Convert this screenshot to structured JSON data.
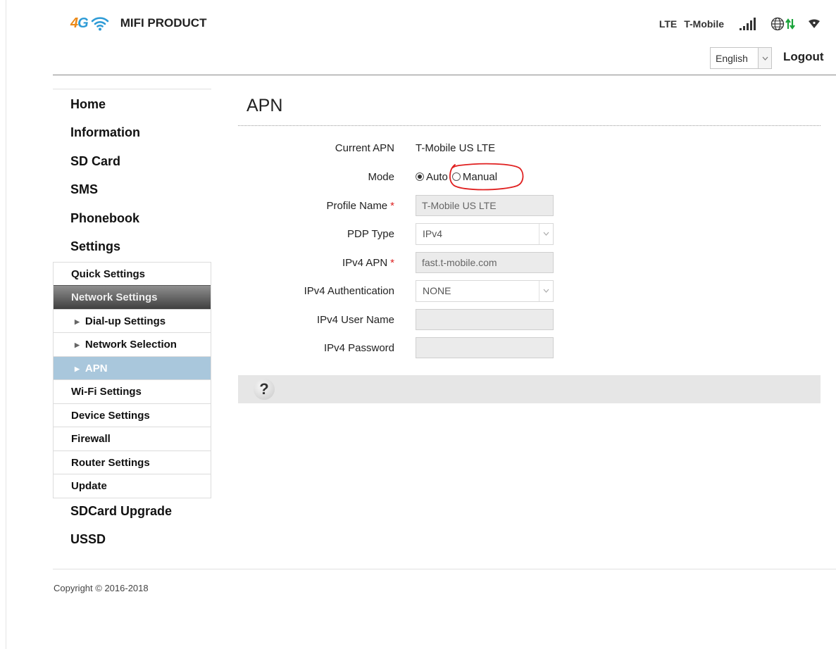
{
  "header": {
    "logo_4": "4",
    "logo_g": "G",
    "brand_title": "MIFI PRODUCT",
    "network_type": "LTE",
    "carrier": "T-Mobile",
    "language": "English",
    "logout_label": "Logout"
  },
  "icons": {
    "wifi": "wifi-icon",
    "signal": "signal-strength-icon",
    "globe": "globe-icon",
    "data_arrows": "data-transfer-icon",
    "wifi_clients": "wifi-clients-icon",
    "help": "help-icon"
  },
  "colors": {
    "logo_4": "#ec8a1a",
    "logo_g": "#2e9bd6",
    "active_nav": "#a9c7dc",
    "data_arrows": "#1aa33a",
    "annotation": "#e02020"
  },
  "sidebar": {
    "top_items": [
      "Home",
      "Information",
      "SD Card",
      "SMS",
      "Phonebook",
      "Settings"
    ],
    "settings_items": {
      "quick": "Quick Settings",
      "network": "Network Settings",
      "dialup": "Dial-up Settings",
      "network_selection": "Network Selection",
      "apn": "APN",
      "wifi": "Wi-Fi Settings",
      "device": "Device Settings",
      "firewall": "Firewall",
      "router": "Router Settings",
      "update": "Update"
    },
    "bottom_items": [
      "SDCard Upgrade",
      "USSD"
    ]
  },
  "main": {
    "title": "APN",
    "current_apn_label": "Current APN",
    "current_apn_value": "T-Mobile US LTE",
    "mode_label": "Mode",
    "mode_auto": "Auto",
    "mode_manual": "Manual",
    "mode_selected": "Auto",
    "profile_name_label": "Profile Name",
    "profile_name_value": "T-Mobile US LTE",
    "pdp_type_label": "PDP Type",
    "pdp_type_value": "IPv4",
    "ipv4_apn_label": "IPv4 APN",
    "ipv4_apn_value": "fast.t-mobile.com",
    "ipv4_auth_label": "IPv4 Authentication",
    "ipv4_auth_value": "NONE",
    "ipv4_user_label": "IPv4 User Name",
    "ipv4_user_value": "",
    "ipv4_password_label": "IPv4 Password",
    "ipv4_password_value": "",
    "required_mark": "*",
    "help_glyph": "?"
  },
  "footer": {
    "copyright": "Copyright © 2016-2018"
  }
}
